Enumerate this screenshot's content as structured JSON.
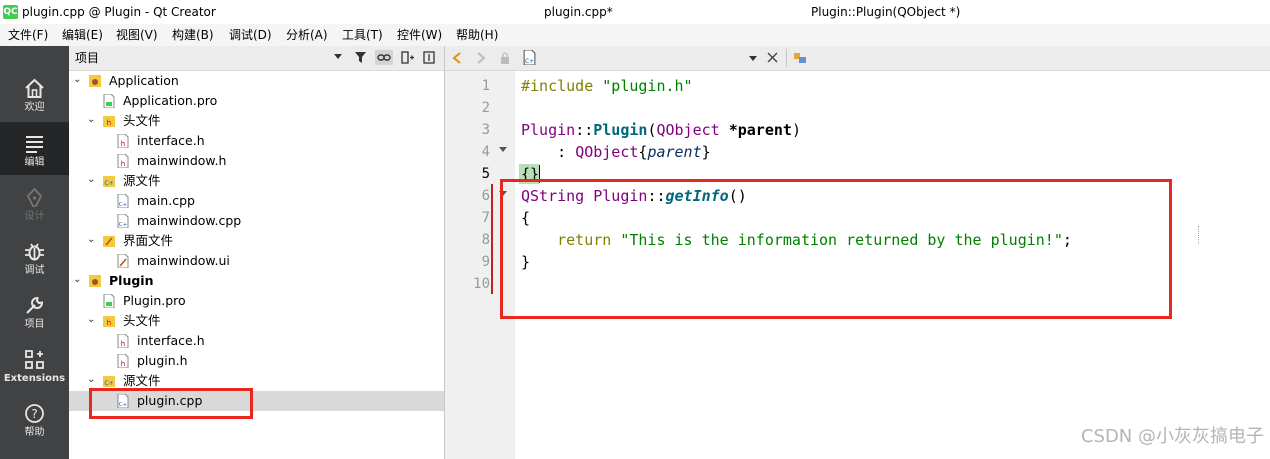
{
  "window": {
    "title": "plugin.cpp @ Plugin - Qt Creator",
    "app_icon": "QC"
  },
  "menu": [
    "文件(F)",
    "编辑(E)",
    "视图(V)",
    "构建(B)",
    "调试(D)",
    "分析(A)",
    "工具(T)",
    "控件(W)",
    "帮助(H)"
  ],
  "modes": [
    {
      "label": "欢迎",
      "icon": "home-icon"
    },
    {
      "label": "编辑",
      "icon": "edit-document-icon"
    },
    {
      "label": "设计",
      "icon": "pen-icon"
    },
    {
      "label": "调试",
      "icon": "bug-icon"
    },
    {
      "label": "项目",
      "icon": "wrench-icon"
    },
    {
      "label": "Extensions",
      "icon": "extensions-icon"
    },
    {
      "label": "帮助",
      "icon": "help-icon"
    }
  ],
  "project_panel": {
    "title": "项目",
    "tree": [
      {
        "text": "Application",
        "level": 0,
        "kind": "project"
      },
      {
        "text": "Application.pro",
        "level": 1,
        "kind": "pro"
      },
      {
        "text": "头文件",
        "level": 1,
        "kind": "folder-h"
      },
      {
        "text": "interface.h",
        "level": 2,
        "kind": "h"
      },
      {
        "text": "mainwindow.h",
        "level": 2,
        "kind": "h"
      },
      {
        "text": "源文件",
        "level": 1,
        "kind": "folder-cpp"
      },
      {
        "text": "main.cpp",
        "level": 2,
        "kind": "cpp"
      },
      {
        "text": "mainwindow.cpp",
        "level": 2,
        "kind": "cpp"
      },
      {
        "text": "界面文件",
        "level": 1,
        "kind": "folder-ui"
      },
      {
        "text": "mainwindow.ui",
        "level": 2,
        "kind": "ui"
      },
      {
        "text": "Plugin",
        "level": 0,
        "kind": "project"
      },
      {
        "text": "Plugin.pro",
        "level": 1,
        "kind": "pro"
      },
      {
        "text": "头文件",
        "level": 1,
        "kind": "folder-h"
      },
      {
        "text": "interface.h",
        "level": 2,
        "kind": "h"
      },
      {
        "text": "plugin.h",
        "level": 2,
        "kind": "h"
      },
      {
        "text": "源文件",
        "level": 1,
        "kind": "folder-cpp"
      },
      {
        "text": "plugin.cpp",
        "level": 2,
        "kind": "cpp",
        "selected": true
      }
    ]
  },
  "editor": {
    "file_tab": "plugin.cpp*",
    "symbol": "Plugin::Plugin(QObject *)",
    "current_line": 5,
    "line_numbers": [
      "1",
      "2",
      "3",
      "4",
      "5",
      "6",
      "7",
      "8",
      "9",
      "10"
    ],
    "lines": [
      "#include \"plugin.h\"",
      "",
      "Plugin::Plugin(QObject *parent)",
      "    : QObject{parent}",
      "{}",
      "QString Plugin::getInfo()",
      "{",
      "    return \"This is the information returned by the plugin!\";",
      "}",
      ""
    ]
  },
  "watermark": "CSDN @小灰灰搞电子",
  "colors": {
    "highlight_box": "#e8271f",
    "mode_bar": "#404244",
    "keyword": "#808000",
    "string": "#008000"
  }
}
